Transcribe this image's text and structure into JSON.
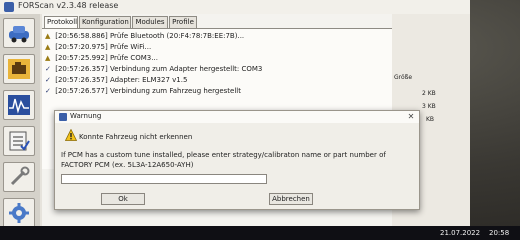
{
  "window": {
    "title": "FORScan v2.3.48 release"
  },
  "tabs": [
    "Protokoll",
    "Konfiguration",
    "Modules",
    "Profile"
  ],
  "log": [
    {
      "icon": "warning",
      "text": "[20:56:58.886] Prüfe Bluetooth (20:F4:78:7B:EE:7B)..."
    },
    {
      "icon": "warning",
      "text": "[20:57:20.975] Prüfe WiFi..."
    },
    {
      "icon": "warning",
      "text": "[20:57:25.992] Prüfe COM3..."
    },
    {
      "icon": "check",
      "text": "[20:57:26.357] Verbindung zum Adapter hergestellt: COM3"
    },
    {
      "icon": "check",
      "text": "[20:57:26.357] Adapter:  ELM327 v1.5"
    },
    {
      "icon": "check",
      "text": "[20:57:26.577] Verbindung zum Fahrzeug hergestellt"
    }
  ],
  "right_panel": {
    "size_header": "Größe",
    "sizes": [
      "2 KB",
      "3 KB",
      "KB"
    ]
  },
  "dialog": {
    "title": "Warnung",
    "heading": "Konnte Fahrzeug nicht erkennen",
    "message_line1": "If PCM has a custom tune installed, please enter strategy/calibraton name or part number of",
    "message_line2": "FACTORY PCM (ex. 5L3A-12A650-AYH)",
    "input_value": "",
    "ok_label": "Ok",
    "cancel_label": "Abbrechen",
    "close_glyph": "✕"
  },
  "taskbar": {
    "date": "21.07.2022",
    "time": "20:58"
  },
  "icons": {
    "warning": "warning-icon",
    "check": "check-icon"
  },
  "colors": {
    "window_bg": "#e6e3dc",
    "log_bg": "#fcfbf8",
    "taskbar_bg": "#0f0f14"
  }
}
